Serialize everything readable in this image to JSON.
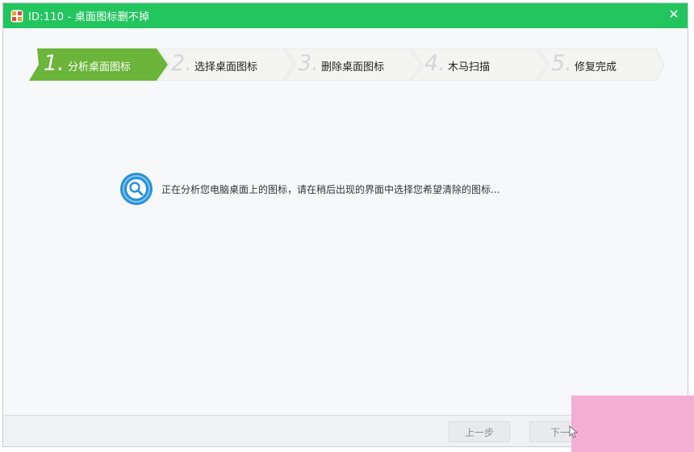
{
  "window": {
    "title": "ID:110 - 桌面图标删不掉",
    "accent_color": "#22c55e",
    "close_icon": "close-icon"
  },
  "steps": [
    {
      "number": "1.",
      "label": "分析桌面图标",
      "active": true
    },
    {
      "number": "2.",
      "label": "选择桌面图标",
      "active": false
    },
    {
      "number": "3.",
      "label": "删除桌面图标",
      "active": false
    },
    {
      "number": "4.",
      "label": "木马扫描",
      "active": false
    },
    {
      "number": "5.",
      "label": "修复完成",
      "active": false
    }
  ],
  "status": {
    "icon": "search-icon",
    "message": "正在分析您电脑桌面上的图标，请在稍后出现的界面中选择您希望清除的图标..."
  },
  "footer": {
    "prev_label": "上一步",
    "next_label": "下一"
  },
  "colors": {
    "active_step": "#6ab53a",
    "inactive_step": "#f4f4f3",
    "overlay": "#f2afd3"
  }
}
